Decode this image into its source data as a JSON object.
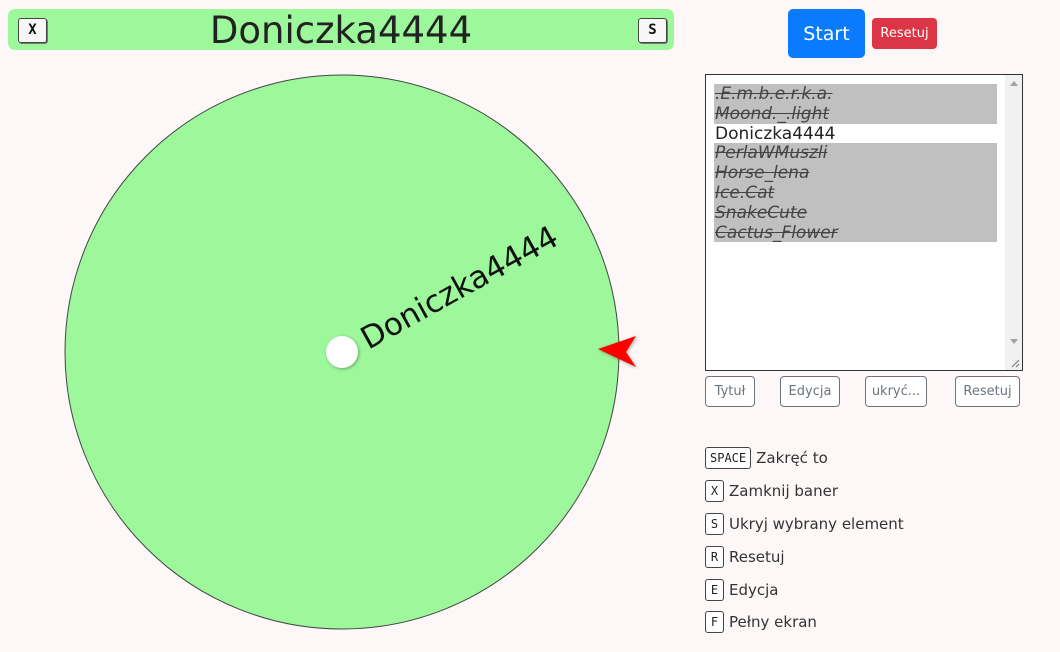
{
  "banner": {
    "title": "Doniczka4444",
    "close_key": "X",
    "hide_key": "S"
  },
  "wheel": {
    "segment_label": "Doniczka4444",
    "segment_color": "#9cf89a",
    "pointer_color": "#ff0000"
  },
  "controls": {
    "start_label": "Start",
    "reset_label": "Resetuj"
  },
  "list": {
    "entries": [
      {
        "text": ".E.m.b.e.r.k.a.",
        "hidden": true
      },
      {
        "text": "Moond._.light",
        "hidden": true
      },
      {
        "text": "Doniczka4444",
        "hidden": false
      },
      {
        "text": "PerlaWMuszli",
        "hidden": true
      },
      {
        "text": "Horse_lena",
        "hidden": true
      },
      {
        "text": "Ice.Cat",
        "hidden": true
      },
      {
        "text": "SnakeCute",
        "hidden": true
      },
      {
        "text": "Cactus_Flower",
        "hidden": true
      }
    ]
  },
  "list_buttons": {
    "title": "Tytuł",
    "edit": "Edycja",
    "hide": "ukryć...",
    "reset": "Resetuj"
  },
  "shortcuts": [
    {
      "key": "SPACE",
      "label": "Zakręć to"
    },
    {
      "key": "X",
      "label": "Zamknij baner"
    },
    {
      "key": "S",
      "label": "Ukryj wybrany element"
    },
    {
      "key": "R",
      "label": "Resetuj"
    },
    {
      "key": "E",
      "label": "Edycja"
    },
    {
      "key": "F",
      "label": "Pełny ekran"
    }
  ],
  "colors": {
    "start": "#0a7bff",
    "reset": "#dc3545",
    "hidden_entry_bg": "#c0c0c0"
  }
}
